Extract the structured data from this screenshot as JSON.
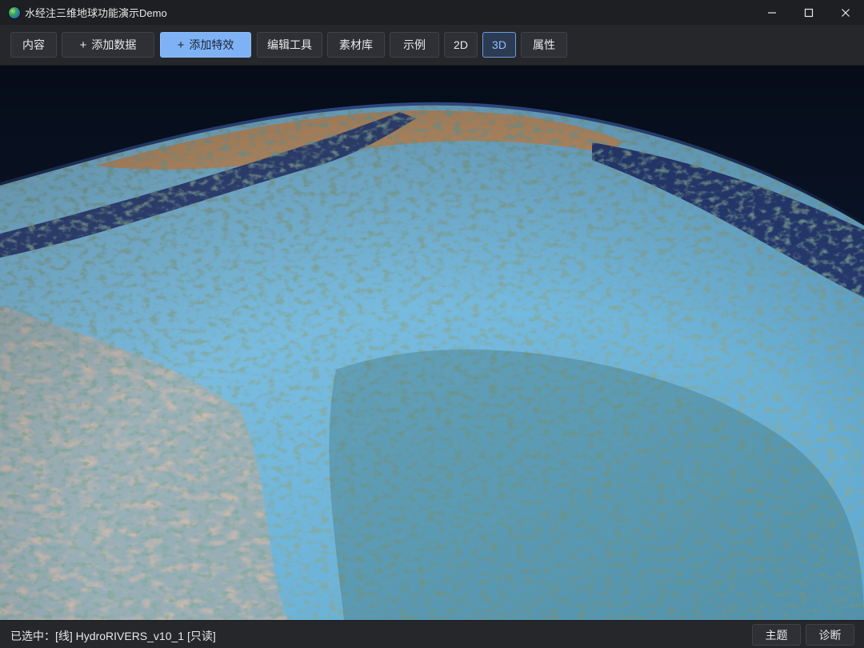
{
  "window": {
    "title": "水经注三维地球功能演示Demo",
    "app_icon": "globe-app-icon",
    "controls": [
      "minimize-icon",
      "maximize-icon",
      "close-icon"
    ]
  },
  "toolbar": {
    "content_label": "内容",
    "add_data_label": "添加数据",
    "add_effect_label": "添加特效",
    "edit_tools_label": "编辑工具",
    "materials_label": "素材库",
    "examples_label": "示例",
    "view_2d_label": "2D",
    "view_3d_label": "3D",
    "properties_label": "属性",
    "plus_symbol": "+",
    "active_view": "3D"
  },
  "status": {
    "selected_text": "已选中：[线] HydroRIVERS_v10_1 [只读]",
    "theme_label": "主题",
    "diagnose_label": "诊断"
  },
  "colors": {
    "primary_button": "#7fb2f5",
    "active_accent": "#6a9de0",
    "land_blue": "#7ec3e6",
    "river_green": "#3f6a5c",
    "desert": "#c99a6e",
    "water": "#2c3f78"
  }
}
